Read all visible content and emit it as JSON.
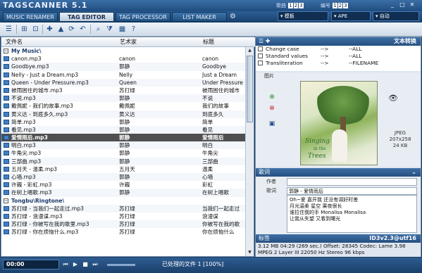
{
  "app": {
    "title": "TAGSCANNER 5.1"
  },
  "header": {
    "label_a": "歌曲",
    "nums_a": [
      "1",
      "2",
      "3"
    ],
    "label_b": "编号",
    "nums_b": [
      "1",
      "2",
      "3"
    ],
    "win_btns": [
      "_",
      "□",
      "✕"
    ]
  },
  "tabs": [
    {
      "label": "MUSIC RENAMER"
    },
    {
      "label": "TAG EDITOR"
    },
    {
      "label": "TAG PROCESSOR"
    },
    {
      "label": "LIST MAKER"
    }
  ],
  "controls": {
    "profile": "▾ 模板",
    "ape": "▾ APE",
    "mode": "▾ 自动"
  },
  "file_list": {
    "columns": [
      "文件名",
      "艺术家",
      "标题"
    ],
    "rows": [
      {
        "kind": "group",
        "name": "My Music\\"
      },
      {
        "kind": "file",
        "file": "canon.mp3",
        "artist": "canon",
        "title": "canon"
      },
      {
        "kind": "file",
        "file": "Goodbye.mp3",
        "artist": "郭静",
        "title": "Goodbye"
      },
      {
        "kind": "file",
        "file": "Nelly - Just a Dream.mp3",
        "artist": "Nelly",
        "title": "Just a Dream"
      },
      {
        "kind": "file",
        "file": "Queen - Under Pressure.mp3",
        "artist": "Queen",
        "title": "Under Pressure"
      },
      {
        "kind": "file",
        "file": "被雨困住的城市.mp3",
        "artist": "苏打绿",
        "title": "被雨困住的城市"
      },
      {
        "kind": "file",
        "file": "不说.mp3",
        "artist": "郭静",
        "title": "不说"
      },
      {
        "kind": "file",
        "file": "戴佩妮 - 我们的故事.mp3",
        "artist": "戴佩妮",
        "title": "我们的故事"
      },
      {
        "kind": "file",
        "file": "黄义达 - 到底多久.mp3",
        "artist": "黄义达",
        "title": "到底多久"
      },
      {
        "kind": "file",
        "file": "简单.mp3",
        "artist": "郭静",
        "title": "简单"
      },
      {
        "kind": "file",
        "file": "看见.mp3",
        "artist": "郭静",
        "title": "看见"
      },
      {
        "kind": "file",
        "file": "爱情雨后.mp3",
        "artist": "郭静",
        "title": "爱情雨后",
        "selected": true
      },
      {
        "kind": "file",
        "file": "明白.mp3",
        "artist": "郭静",
        "title": "明白"
      },
      {
        "kind": "file",
        "file": "牛角尖.mp3",
        "artist": "郭静",
        "title": "牛角尖"
      },
      {
        "kind": "file",
        "file": "三部曲.mp3",
        "artist": "郭静",
        "title": "三部曲"
      },
      {
        "kind": "file",
        "file": "五月天 - 温柔.mp3",
        "artist": "五月天",
        "title": "温柔"
      },
      {
        "kind": "file",
        "file": "心墙.mp3",
        "artist": "郭静",
        "title": "心墙"
      },
      {
        "kind": "file",
        "file": "许巍 - 彩虹.mp3",
        "artist": "许巍",
        "title": "彩虹"
      },
      {
        "kind": "file",
        "file": "在树上唱歌.mp3",
        "artist": "郭静",
        "title": "在树上唱歌"
      },
      {
        "kind": "group",
        "name": "Tongbu\\Ringtone\\"
      },
      {
        "kind": "file",
        "file": "苏打绿 - 当我们一起走过.mp3",
        "artist": "苏打绿",
        "title": "当我们一起走过"
      },
      {
        "kind": "file",
        "file": "苏打绿 - 浪漫谋.mp3",
        "artist": "苏打绿",
        "title": "浪漫谋"
      },
      {
        "kind": "file",
        "file": "苏打绿 - 你被写在我的歌里.mp3",
        "artist": "苏打绿",
        "title": "你被写在我的歌"
      },
      {
        "kind": "file",
        "file": "苏打绿 - 你在烦恼什么.mp3",
        "artist": "苏打绿",
        "title": "你在烦恼什么"
      }
    ]
  },
  "transform": {
    "header": "文本转换",
    "rows": [
      {
        "name": "Change case",
        "arrow": "-->",
        "value": "--ALL"
      },
      {
        "name": "Standard values",
        "arrow": "-->",
        "value": "--ALL"
      },
      {
        "name": "Transliteration",
        "arrow": "-->",
        "value": "--FILENAME"
      }
    ]
  },
  "cover": {
    "label": "图片",
    "title_lines": [
      "Singing",
      "in the",
      "Trees"
    ],
    "format": "JPEG",
    "dimensions": "207x258",
    "size": "24 KB"
  },
  "lyrics": {
    "header": "歌词",
    "author_label": "作者",
    "author_value": "",
    "lyrics_label": "歌词",
    "lyrics_first": "郭静 - 爱情雨后",
    "lyrics_lines": [
      "Oh~爱 嘉开我 还没有调好时差",
      "月光温柔 星空 果夜很长",
      "谁拉住我的手 Monalisa Monalisa",
      "让我从失望 又看到曙光"
    ]
  },
  "tag": {
    "header": "标签",
    "version": "ID3v2.3@utf16",
    "line1": "3.12 MB 04:29 (269 sec.)  Offset: 28345  Codec: Lame 3.98",
    "line2": "MPEG 2 Layer III  22050 Hz  Stereo  96 kbps"
  },
  "status": {
    "time": "00:00",
    "processed": "已处理的文件 1 [100%]"
  }
}
